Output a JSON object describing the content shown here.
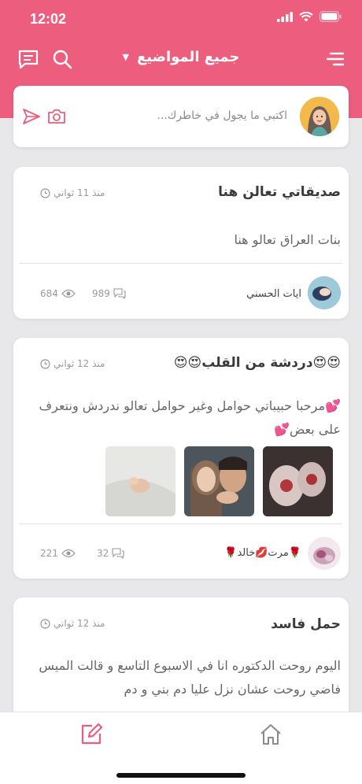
{
  "status_bar": {
    "time": "12:02"
  },
  "header": {
    "title": "جميع المواضيع",
    "caret": "▼"
  },
  "composer": {
    "placeholder": "اكتبي ما يجول في خاطرك..."
  },
  "posts": [
    {
      "title": "صديقاتي تعالن هنا",
      "time_ago": "منذ 11 ثواني",
      "body": "بنات العراق تعالو هنا",
      "author": "ايات الحسني",
      "comments": "989",
      "views": "684"
    },
    {
      "title": "😍😍دردشة من القلب😍😍",
      "time_ago": "منذ 12 ثواني",
      "body": "💕مرحبا حبيباتي حوامل وغير حوامل تعالو ندردش ونتعرف على بعض💕",
      "author": "🌹مرت💋خالد🌹",
      "comments": "32",
      "views": "221"
    },
    {
      "title": "حمل فاسد",
      "time_ago": "منذ 12 ثواني",
      "body": "اليوم روحت الدكتوره انا في الاسبوع التاسع و قالت الميس فاضي روحت عشان نزل عليا دم بني و دم"
    }
  ],
  "tabbar": {
    "left_icon": "edit-icon",
    "right_icon": "home-icon"
  },
  "colors": {
    "brand": "#ec5d7e",
    "background": "#e8e8ea"
  }
}
